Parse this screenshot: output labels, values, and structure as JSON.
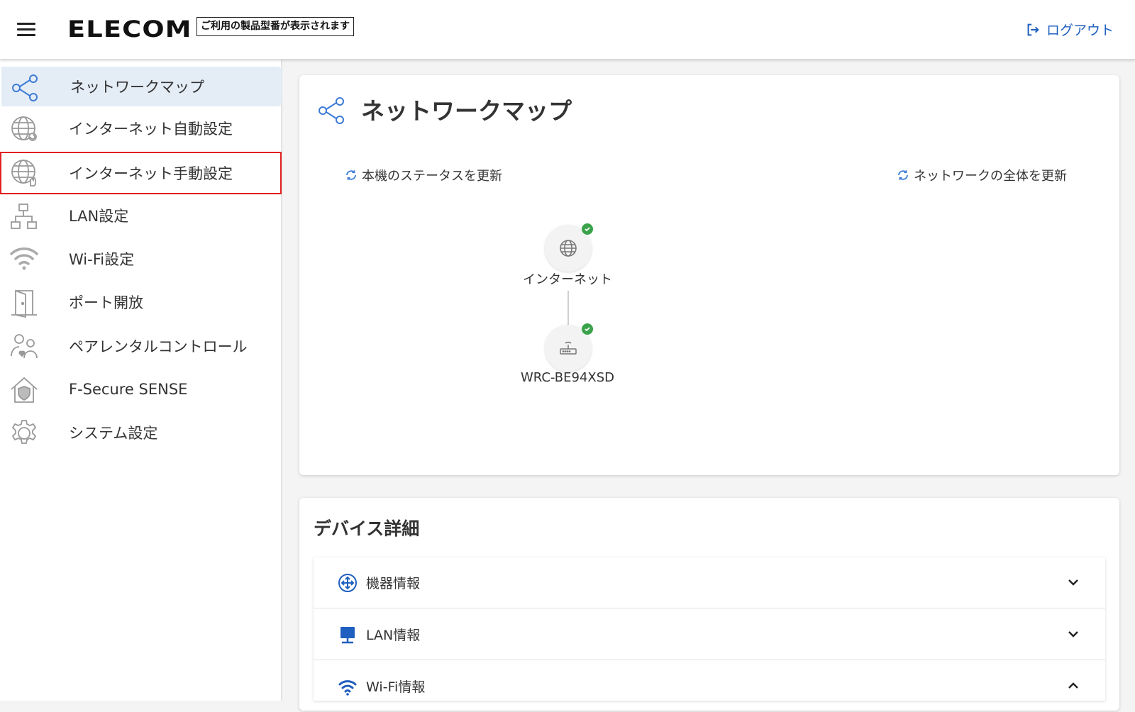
{
  "header": {
    "logo": "ELECOM",
    "model_placeholder": "ご利用の製品型番が表示されます",
    "logout_label": "ログアウト"
  },
  "sidebar": {
    "items": [
      {
        "label": "ネットワークマップ",
        "icon": "share-network-icon",
        "state": "active"
      },
      {
        "label": "インターネット自動設定",
        "icon": "globe-auto-icon"
      },
      {
        "label": "インターネット手動設定",
        "icon": "globe-manual-icon",
        "state": "highlighted"
      },
      {
        "label": "LAN設定",
        "icon": "lan-topology-icon"
      },
      {
        "label": "Wi-Fi設定",
        "icon": "wifi-icon"
      },
      {
        "label": "ポート開放",
        "icon": "door-icon"
      },
      {
        "label": "ペアレンタルコントロール",
        "icon": "parent-child-icon"
      },
      {
        "label": "F-Secure SENSE",
        "icon": "home-shield-icon"
      },
      {
        "label": "システム設定",
        "icon": "gear-icon"
      }
    ]
  },
  "network_map": {
    "title": "ネットワークマップ",
    "refresh_device": "本機のステータスを更新",
    "refresh_network": "ネットワークの全体を更新",
    "nodes": [
      {
        "label": "インターネット",
        "icon": "globe-icon",
        "status": "ok"
      },
      {
        "label": "WRC-BE94XSD",
        "icon": "router-icon",
        "status": "ok"
      }
    ]
  },
  "device_details": {
    "title": "デバイス詳細",
    "sections": [
      {
        "label": "機器情報",
        "icon": "device-info-icon",
        "expanded": false
      },
      {
        "label": "LAN情報",
        "icon": "lan-monitor-icon",
        "expanded": false
      },
      {
        "label": "Wi-Fi情報",
        "icon": "wifi-icon",
        "expanded": true
      }
    ]
  },
  "colors": {
    "accent": "#1f5fbf",
    "active_bg": "#e4ecf6",
    "focus_outline": "#e02020",
    "status_ok": "#3aa34a"
  }
}
